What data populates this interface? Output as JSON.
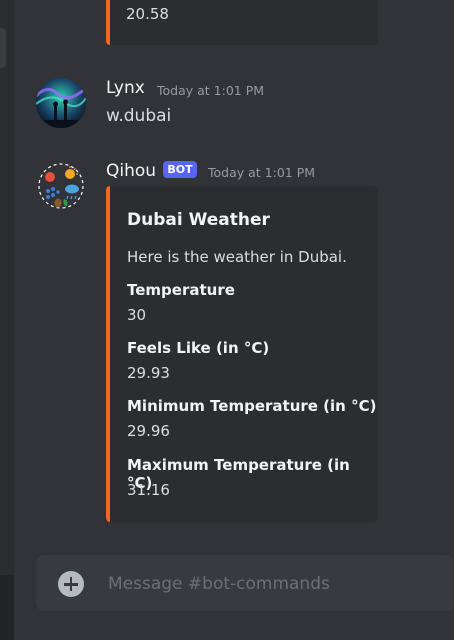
{
  "previous_embed": {
    "value": "20.58"
  },
  "messages": [
    {
      "username": "Lynx",
      "timestamp": "Today at 1:01 PM",
      "content": "w.dubai"
    },
    {
      "username": "Qihou",
      "badge": "BOT",
      "timestamp": "Today at 1:01 PM"
    }
  ],
  "embed": {
    "title": "Dubai Weather",
    "description": "Here is the weather in Dubai.",
    "fields": [
      {
        "name": "Temperature",
        "value": "30"
      },
      {
        "name": "Feels Like (in °C)",
        "value": "29.93"
      },
      {
        "name": "Minimum Temperature (in °C)",
        "value": "29.96"
      },
      {
        "name": "Maximum Temperature (in °C)",
        "value": "31.16"
      }
    ],
    "accent_color": "#f26522"
  },
  "composer": {
    "placeholder": "Message #bot-commands"
  },
  "colors": {
    "background": "#313338",
    "embed_bg": "#2b2d31",
    "bot_badge": "#5865f2"
  }
}
